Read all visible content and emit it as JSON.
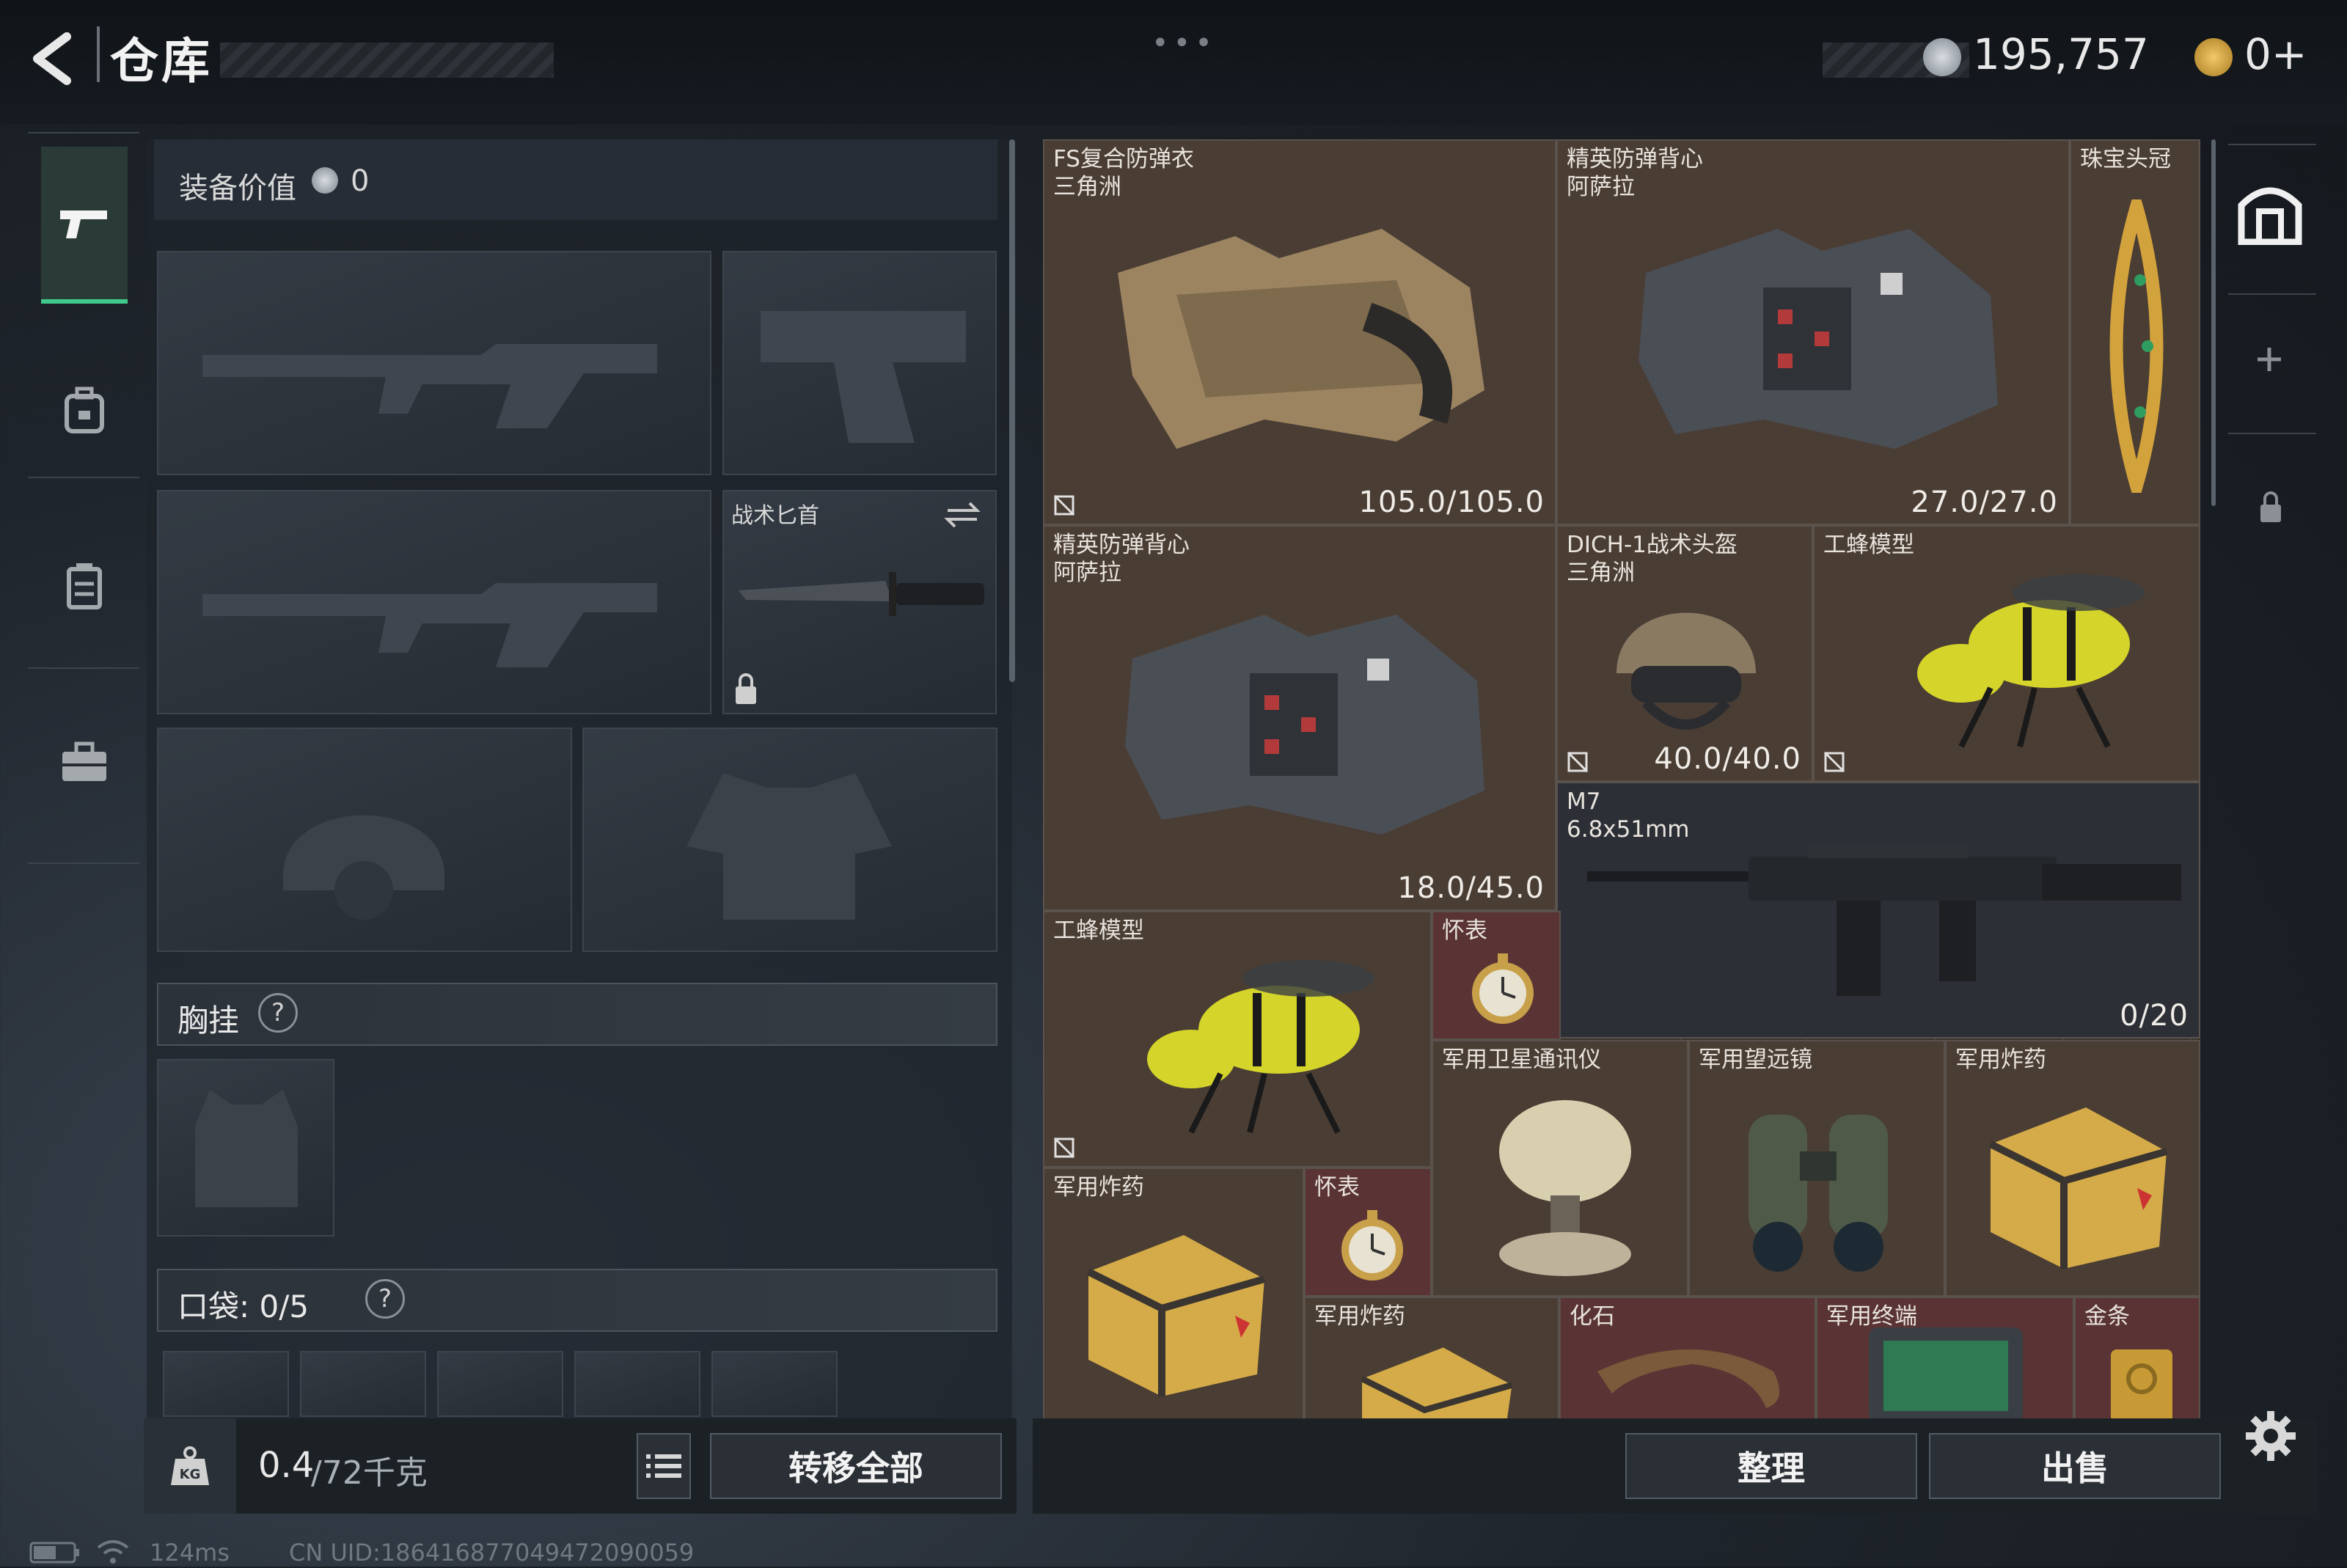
{
  "header": {
    "title": "仓库",
    "currency_value": "195,757",
    "premium_value": "0+",
    "menu_dots": "•••"
  },
  "loadout": {
    "equip_value_label": "装备价值",
    "equip_value": "0",
    "knife_label": "战术匕首",
    "chest_rig_label": "胸挂",
    "pocket_label": "口袋: 0/5",
    "help": "?"
  },
  "footer": {
    "weight": "0.4",
    "weight_max": "/72千克",
    "transfer_all": "转移全部",
    "organize": "整理",
    "sell": "出售"
  },
  "status": {
    "ping": "124ms",
    "uid": "CN UID:18641687704947209005​9"
  },
  "items": [
    {
      "name": "FS复合防弹衣\n三角洲",
      "value": "105.0/105.0"
    },
    {
      "name": "精英防弹背心\n阿萨拉",
      "value": "27.0/27.0"
    },
    {
      "name": "珠宝头冠",
      "value": ""
    },
    {
      "name": "精英防弹背心\n阿萨拉",
      "value": "18.0/45.0"
    },
    {
      "name": "DICH-1战术头盔\n三角洲",
      "value": "40.0/40.0"
    },
    {
      "name": "工蜂模型",
      "value": ""
    },
    {
      "name": "M7\n6.8x51mm",
      "value": "0/20"
    },
    {
      "name": "工蜂模型",
      "value": ""
    },
    {
      "name": "怀表",
      "value": ""
    },
    {
      "name": "军用卫星通讯仪",
      "value": ""
    },
    {
      "name": "军用望远镜",
      "value": ""
    },
    {
      "name": "军用炸药",
      "value": ""
    },
    {
      "name": "军用炸药",
      "value": ""
    },
    {
      "name": "怀表",
      "value": ""
    },
    {
      "name": "军用炸药",
      "value": ""
    },
    {
      "name": "化石",
      "value": ""
    },
    {
      "name": "军用终端",
      "value": ""
    },
    {
      "name": "金条",
      "value": ""
    }
  ],
  "icons": {
    "back": "back-arrow-icon",
    "nav": [
      "gun-icon",
      "backpack-icon",
      "container-icon",
      "briefcase-icon"
    ],
    "right": [
      "safe-icon",
      "plus-icon",
      "lock-icon"
    ],
    "settings": "gear-icon"
  },
  "colors": {
    "accent_green": "#3fc98a",
    "grid_brown": "#4a3d34",
    "grid_red": "#5a3434"
  }
}
